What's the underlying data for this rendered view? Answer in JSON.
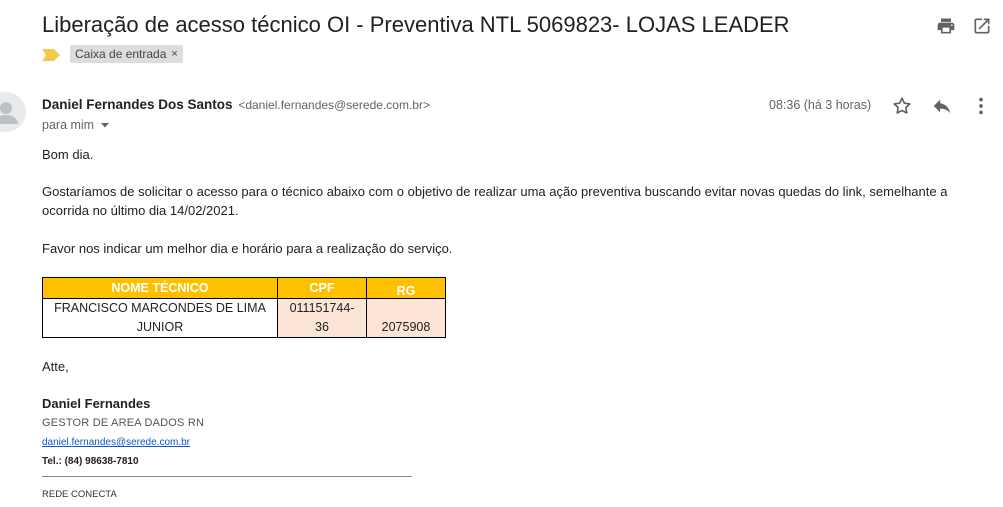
{
  "email": {
    "subject": "Liberação de acesso técnico OI - Preventiva NTL 5069823- LOJAS LEADER",
    "label": "Caixa de entrada",
    "label_remove": "×",
    "sender_name": "Daniel Fernandes Dos Santos",
    "sender_email": "<daniel.fernandes@serede.com.br>",
    "time": "08:36 (há 3 horas)",
    "to": "para mim",
    "greeting": "Bom dia.",
    "paragraph1_line1": "Gostaríamos de solicitar o acesso para o técnico abaixo com o objetivo de realizar uma ação preventiva buscando evitar novas quedas do link, semelhante a",
    "paragraph1_line2": "ocorrida no último dia 14/02/2021.",
    "paragraph2": "Favor nos indicar um melhor dia e horário para a realização do serviço.",
    "table": {
      "headers": [
        "NOME TÉCNICO",
        "CPF",
        "RG"
      ],
      "row": {
        "name_line1": "FRANCISCO MARCONDES DE LIMA",
        "name_line2": "JUNIOR",
        "cpf_line1": "011151744-",
        "cpf_line2": "36",
        "rg": "2075908"
      }
    },
    "closing": "Atte,",
    "signature": {
      "name": "Daniel Fernandes",
      "role": "GESTOR DE AREA DADOS RN",
      "email": "daniel.fernandes@serede.com.br",
      "tel": "Tel.: (84) 98638-7810",
      "company": "REDE CONECTA"
    }
  },
  "icons": {
    "print": "print-icon",
    "open_new_window": "open-in-new-window-icon",
    "label_marker": "important-marker-icon",
    "avatar": "avatar-icon",
    "star": "star-icon",
    "reply": "reply-icon",
    "more": "more-vert-icon",
    "dropdown": "chevron-down-icon"
  },
  "colors": {
    "table_header_bg": "#ffc000",
    "table_cell_bg": "#fce4d6",
    "label_marker": "#f2c94c",
    "link": "#1155cc"
  }
}
